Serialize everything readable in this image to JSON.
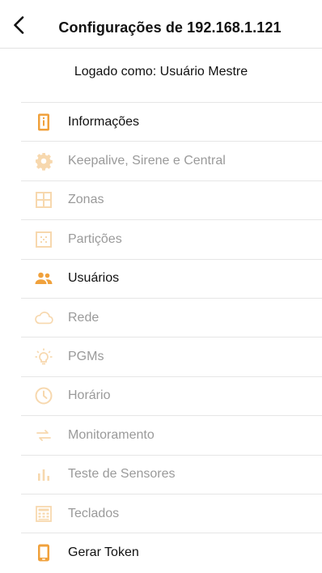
{
  "header": {
    "title": "Configurações de 192.168.1.121"
  },
  "subtitle": "Logado como: Usuário Mestre",
  "colors": {
    "accent": "#f0a13c",
    "accent_disabled": "#f7d8ae",
    "text_disabled": "#9a9a9a"
  },
  "menu": {
    "items": [
      {
        "label": "Informações",
        "icon": "info-icon",
        "enabled": true
      },
      {
        "label": "Keepalive, Sirene e Central",
        "icon": "gear-icon",
        "enabled": false
      },
      {
        "label": "Zonas",
        "icon": "grid-icon",
        "enabled": false
      },
      {
        "label": "Partições",
        "icon": "partition-icon",
        "enabled": false
      },
      {
        "label": "Usuários",
        "icon": "users-icon",
        "enabled": true
      },
      {
        "label": "Rede",
        "icon": "cloud-icon",
        "enabled": false
      },
      {
        "label": "PGMs",
        "icon": "lightbulb-icon",
        "enabled": false
      },
      {
        "label": "Horário",
        "icon": "clock-icon",
        "enabled": false
      },
      {
        "label": "Monitoramento",
        "icon": "arrows-icon",
        "enabled": false
      },
      {
        "label": "Teste de Sensores",
        "icon": "bar-chart-icon",
        "enabled": false
      },
      {
        "label": "Teclados",
        "icon": "keypad-icon",
        "enabled": false
      },
      {
        "label": "Gerar Token",
        "icon": "phone-icon",
        "enabled": true
      }
    ]
  }
}
